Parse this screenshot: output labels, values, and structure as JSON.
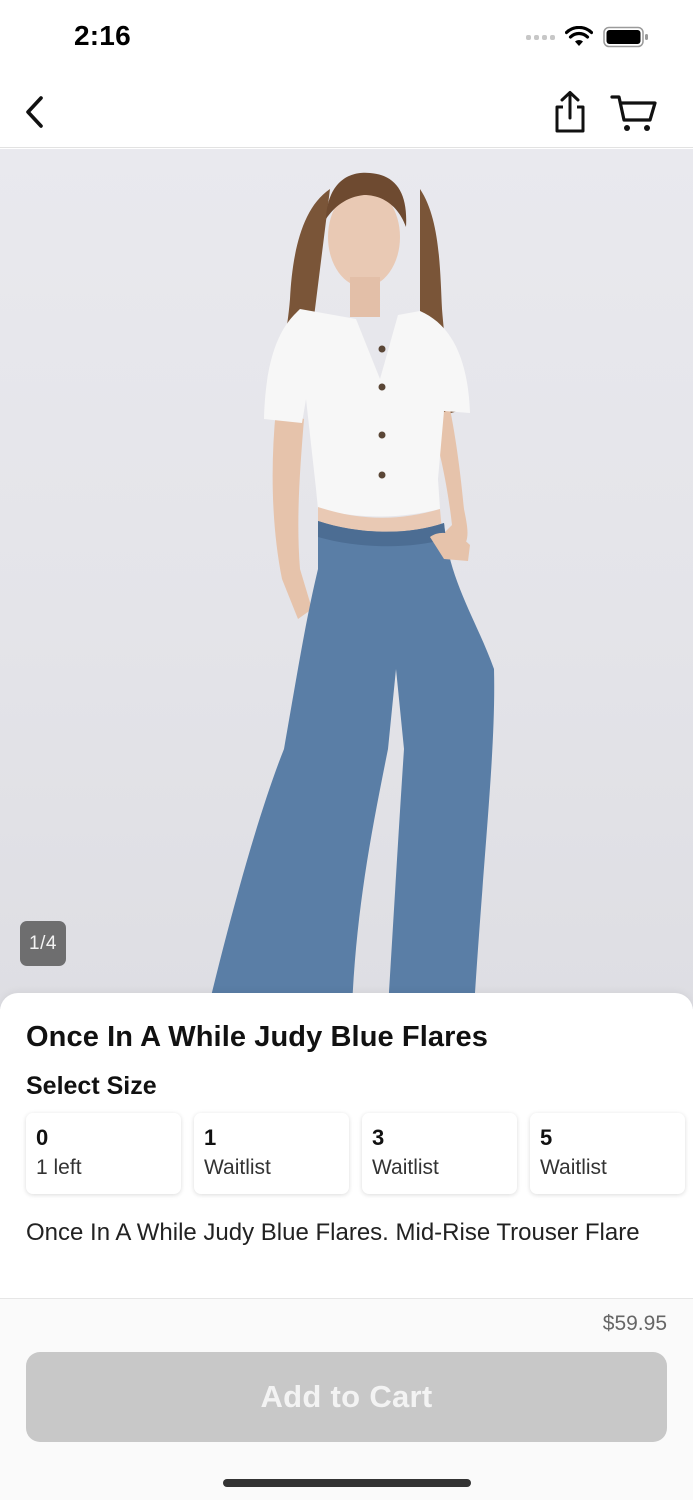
{
  "status_bar": {
    "time": "2:16",
    "icons": [
      "cellular-signal-icon",
      "wifi-icon",
      "battery-icon"
    ]
  },
  "nav": {
    "icons": [
      "back-chevron-icon",
      "share-icon",
      "cart-icon"
    ]
  },
  "gallery": {
    "counter": "1/4"
  },
  "product": {
    "title": "Once In A While Judy Blue Flares",
    "select_size_label": "Select Size",
    "sizes": [
      {
        "value": "0",
        "status": "1 left"
      },
      {
        "value": "1",
        "status": "Waitlist"
      },
      {
        "value": "3",
        "status": "Waitlist"
      },
      {
        "value": "5",
        "status": "Waitlist"
      }
    ],
    "description": "Once In A While Judy Blue Flares. Mid-Rise Trouser Flare"
  },
  "checkout": {
    "price": "$59.95",
    "add_to_cart_label": "Add to Cart"
  },
  "colors": {
    "button_disabled": "#c8c8c8",
    "text_primary": "#111111",
    "price_text": "#666666"
  }
}
